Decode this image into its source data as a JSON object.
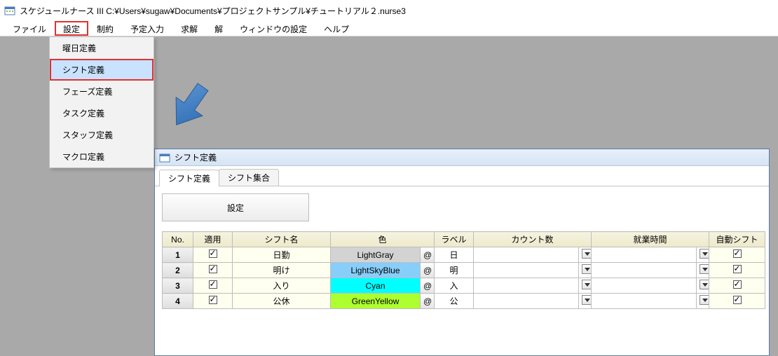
{
  "app": {
    "title": "スケジュールナース III   C:¥Users¥sugaw¥Documents¥プロジェクトサンプル¥チュートリアル２.nurse3"
  },
  "menubar": {
    "items": [
      "ファイル",
      "設定",
      "制約",
      "予定入力",
      "求解",
      "解",
      "ウィンドウの設定",
      "ヘルプ"
    ],
    "highlight_index": 1
  },
  "dropdown": {
    "items": [
      "曜日定義",
      "シフト定義",
      "フェーズ定義",
      "タスク定義",
      "スタッフ定義",
      "マクロ定義"
    ],
    "highlight_index": 1
  },
  "child_window": {
    "title": "シフト定義",
    "tabs": [
      "シフト定義",
      "シフト集合"
    ],
    "active_tab": 0,
    "settings_button": "設定",
    "columns": {
      "no": "No.",
      "apply": "適用",
      "name": "シフト名",
      "color": "色",
      "label": "ラベル",
      "count": "カウント数",
      "work": "就業時間",
      "auto": "自動シフト"
    },
    "rows": [
      {
        "no": "1",
        "apply": true,
        "name": "日勤",
        "color": "LightGray",
        "color_class": "LightGray",
        "at": "@",
        "label": "日",
        "count": "",
        "work": "",
        "auto": true
      },
      {
        "no": "2",
        "apply": true,
        "name": "明け",
        "color": "LightSkyBlue",
        "color_class": "LightSkyBlue",
        "at": "@",
        "label": "明",
        "count": "",
        "work": "",
        "auto": true
      },
      {
        "no": "3",
        "apply": true,
        "name": "入り",
        "color": "Cyan",
        "color_class": "Cyan",
        "at": "@",
        "label": "入",
        "count": "",
        "work": "",
        "auto": true
      },
      {
        "no": "4",
        "apply": true,
        "name": "公休",
        "color": "GreenYellow",
        "color_class": "GreenYellow",
        "at": "@",
        "label": "公",
        "count": "",
        "work": "",
        "auto": true
      }
    ]
  }
}
